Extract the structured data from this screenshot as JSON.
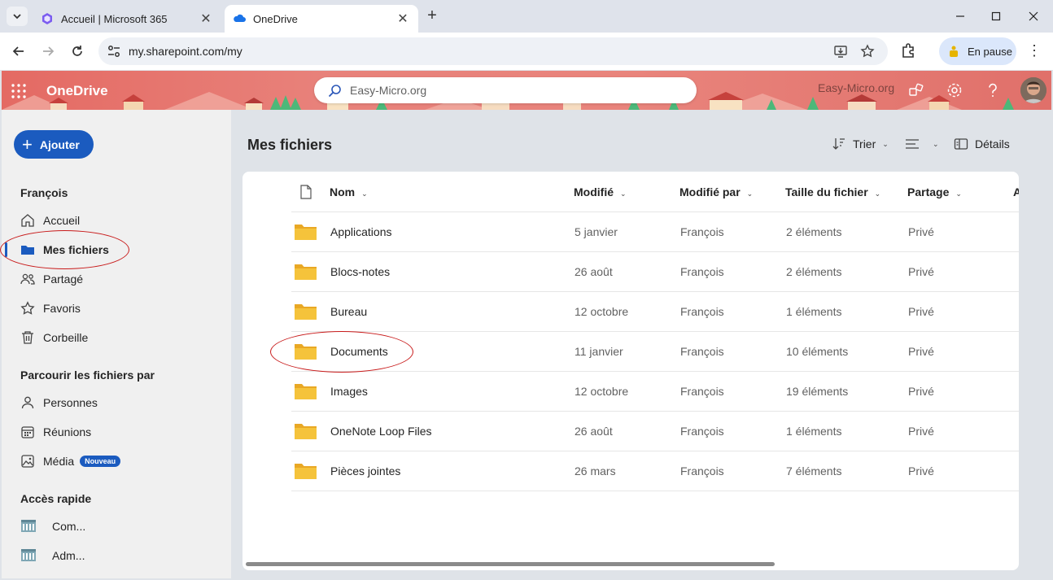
{
  "browser": {
    "tabs": [
      {
        "title": "Accueil | Microsoft 365",
        "active": false
      },
      {
        "title": "OneDrive",
        "active": true
      }
    ],
    "url": "my.sharepoint.com/my",
    "profile_status": "En pause"
  },
  "header": {
    "brand": "OneDrive",
    "search_placeholder": "Easy-Micro.org",
    "org_watermark": "Easy-Micro.org"
  },
  "sidebar": {
    "add_label": "Ajouter",
    "section_user": "François",
    "items": [
      {
        "label": "Accueil",
        "icon": "home-icon",
        "active": false
      },
      {
        "label": "Mes fichiers",
        "icon": "folder-icon",
        "active": true
      },
      {
        "label": "Partagé",
        "icon": "people-icon",
        "active": false
      },
      {
        "label": "Favoris",
        "icon": "star-icon",
        "active": false
      },
      {
        "label": "Corbeille",
        "icon": "trash-icon",
        "active": false
      }
    ],
    "browse_heading": "Parcourir les fichiers par",
    "browse_items": [
      {
        "label": "Personnes",
        "icon": "person-icon"
      },
      {
        "label": "Réunions",
        "icon": "calendar-icon"
      },
      {
        "label": "Média",
        "icon": "image-icon",
        "badge": "Nouveau"
      }
    ],
    "quick_heading": "Accès rapide",
    "quick_items": [
      {
        "label": "Com..."
      },
      {
        "label": "Adm..."
      }
    ]
  },
  "main": {
    "title": "Mes fichiers",
    "commands": {
      "sort": "Trier",
      "details": "Détails"
    },
    "columns": [
      "Nom",
      "Modifié",
      "Modifié par",
      "Taille du fichier",
      "Partage",
      "A"
    ],
    "rows": [
      {
        "name": "Applications",
        "modified": "5 janvier",
        "by": "François",
        "size": "2 éléments",
        "sharing": "Privé"
      },
      {
        "name": "Blocs-notes",
        "modified": "26 août",
        "by": "François",
        "size": "2 éléments",
        "sharing": "Privé"
      },
      {
        "name": "Bureau",
        "modified": "12 octobre",
        "by": "François",
        "size": "1 éléments",
        "sharing": "Privé"
      },
      {
        "name": "Documents",
        "modified": "11 janvier",
        "by": "François",
        "size": "10 éléments",
        "sharing": "Privé"
      },
      {
        "name": "Images",
        "modified": "12 octobre",
        "by": "François",
        "size": "19 éléments",
        "sharing": "Privé"
      },
      {
        "name": "OneNote Loop Files",
        "modified": "26 août",
        "by": "François",
        "size": "1 éléments",
        "sharing": "Privé"
      },
      {
        "name": "Pièces jointes",
        "modified": "26 mars",
        "by": "François",
        "size": "7 éléments",
        "sharing": "Privé"
      }
    ]
  },
  "colors": {
    "accent": "#1b5bbf",
    "annotation": "#c81a1a",
    "folder": "#f5c33b"
  }
}
